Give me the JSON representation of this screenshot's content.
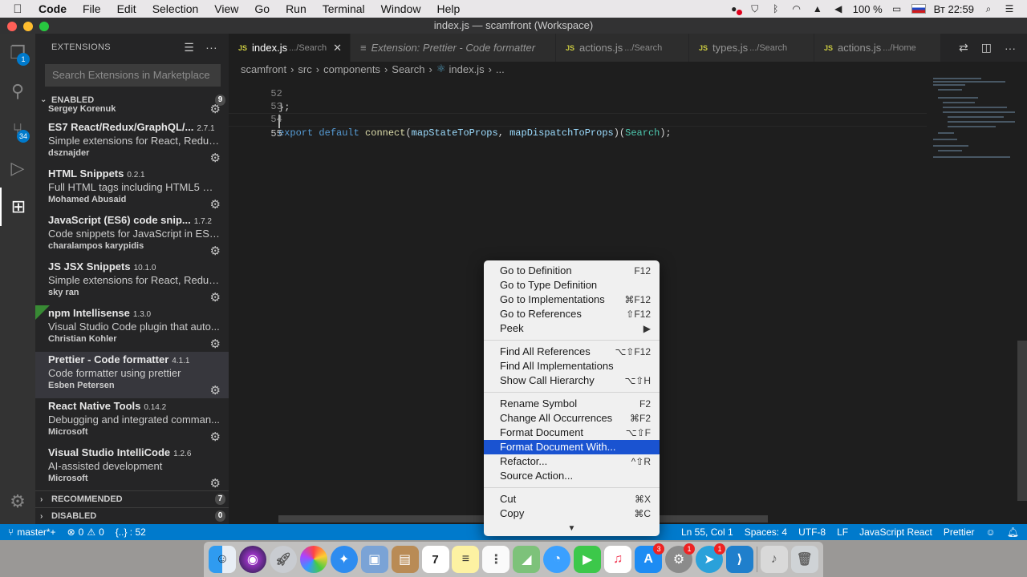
{
  "menubar": {
    "app": "Code",
    "items": [
      "File",
      "Edit",
      "Selection",
      "View",
      "Go",
      "Run",
      "Terminal",
      "Window",
      "Help"
    ],
    "battery": "100 %",
    "clock": "Вт 22:59"
  },
  "window": {
    "title": "index.js — scamfront (Workspace)"
  },
  "activity": {
    "explorer_badge": "1",
    "scm_badge": "34"
  },
  "sidebar": {
    "title": "EXTENSIONS",
    "search_placeholder": "Search Extensions in Marketplace",
    "enabled": {
      "label": "ENABLED",
      "count": "9"
    },
    "recommended": {
      "label": "RECOMMENDED",
      "count": "7"
    },
    "disabled": {
      "label": "DISABLED",
      "count": "0"
    },
    "partial_publisher": "Sergey Korenuk",
    "extensions": [
      {
        "name": "ES7 React/Redux/GraphQL/...",
        "version": "2.7.1",
        "desc": "Simple extensions for React, Redux ...",
        "publisher": "dsznajder"
      },
      {
        "name": "HTML Snippets",
        "version": "0.2.1",
        "desc": "Full HTML tags including HTML5 Sn...",
        "publisher": "Mohamed Abusaid"
      },
      {
        "name": "JavaScript (ES6) code snip...",
        "version": "1.7.2",
        "desc": "Code snippets for JavaScript in ES6...",
        "publisher": "charalampos karypidis"
      },
      {
        "name": "JS JSX Snippets",
        "version": "10.1.0",
        "desc": "Simple extensions for React, Redux ...",
        "publisher": "sky ran"
      },
      {
        "name": "npm Intellisense",
        "version": "1.3.0",
        "desc": "Visual Studio Code plugin that auto...",
        "publisher": "Christian Kohler"
      },
      {
        "name": "Prettier - Code formatter",
        "version": "4.1.1",
        "desc": "Code formatter using prettier",
        "publisher": "Esben Petersen"
      },
      {
        "name": "React Native Tools",
        "version": "0.14.2",
        "desc": "Debugging and integrated comman...",
        "publisher": "Microsoft"
      },
      {
        "name": "Visual Studio IntelliCode",
        "version": "1.2.6",
        "desc": "AI-assisted development",
        "publisher": "Microsoft"
      }
    ]
  },
  "tabs": [
    {
      "label": "index.js",
      "path": ".../Search"
    },
    {
      "label": "Extension: Prettier - Code formatter"
    },
    {
      "label": "actions.js",
      "path": ".../Search"
    },
    {
      "label": "types.js",
      "path": ".../Search"
    },
    {
      "label": "actions.js",
      "path": ".../Home"
    }
  ],
  "breadcrumb": [
    "scamfront",
    "src",
    "components",
    "Search",
    "index.js",
    "..."
  ],
  "editor": {
    "lines": [
      {
        "num": "52",
        "text": "};"
      },
      {
        "num": "53",
        "text": ""
      },
      {
        "num": "54",
        "kw1": "export",
        "kw2": "default",
        "fn": "connect",
        "arg1": "mapStateToProps",
        "comma": ",",
        "arg2": "mapDispatchToProps",
        "cls": "Search",
        "tail": ");"
      },
      {
        "num": "55",
        "text": ""
      }
    ]
  },
  "context_menu": {
    "group1": [
      {
        "label": "Go to Definition",
        "shortcut": "F12"
      },
      {
        "label": "Go to Type Definition",
        "shortcut": ""
      },
      {
        "label": "Go to Implementations",
        "shortcut": "⌘F12"
      },
      {
        "label": "Go to References",
        "shortcut": "⇧F12"
      },
      {
        "label": "Peek",
        "shortcut": "▶"
      }
    ],
    "group2": [
      {
        "label": "Find All References",
        "shortcut": "⌥⇧F12"
      },
      {
        "label": "Find All Implementations",
        "shortcut": ""
      },
      {
        "label": "Show Call Hierarchy",
        "shortcut": "⌥⇧H"
      }
    ],
    "group3": [
      {
        "label": "Rename Symbol",
        "shortcut": "F2"
      },
      {
        "label": "Change All Occurrences",
        "shortcut": "⌘F2"
      },
      {
        "label": "Format Document",
        "shortcut": "⌥⇧F"
      },
      {
        "label": "Format Document With...",
        "shortcut": ""
      },
      {
        "label": "Refactor...",
        "shortcut": "^⇧R"
      },
      {
        "label": "Source Action...",
        "shortcut": ""
      }
    ],
    "group4": [
      {
        "label": "Cut",
        "shortcut": "⌘X"
      },
      {
        "label": "Copy",
        "shortcut": "⌘C"
      }
    ],
    "more": "▼"
  },
  "statusbar": {
    "branch": "master*+",
    "errors": "0",
    "warnings": "0",
    "braces": "{..} : 52",
    "position": "Ln 55, Col 1",
    "spaces": "Spaces: 4",
    "encoding": "UTF-8",
    "eol": "LF",
    "language": "JavaScript React",
    "formatter": "Prettier"
  },
  "dock": {
    "calendar_day": "7",
    "appstore_badge": "3",
    "prefs_badge": "1",
    "telegram_badge": "1"
  }
}
